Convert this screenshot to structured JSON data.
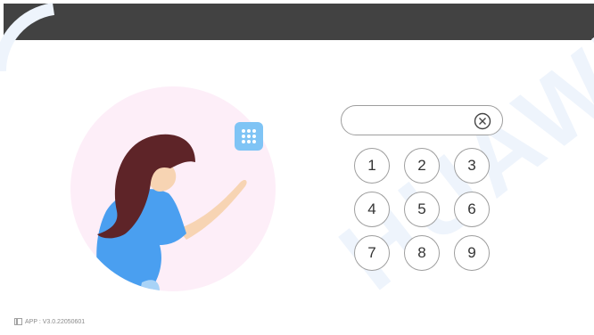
{
  "app": {
    "version_text": "APP : V3.0.22050601"
  },
  "keypad": {
    "keys": [
      "1",
      "2",
      "3",
      "4",
      "5",
      "6",
      "7",
      "8",
      "9"
    ]
  },
  "pin_input": {
    "value": ""
  },
  "watermark": {
    "text": "HUAWEI"
  },
  "icons": {
    "clear": "clear-circle-icon",
    "keypad": "keypad-grid-icon",
    "version": "device-icon"
  },
  "colors": {
    "topbar": "#424242",
    "keypad_icon_bg": "#7fc4f5",
    "circle_bg": "#fdeef8",
    "hair": "#5e2428",
    "shirt": "#4a9ff0",
    "skin": "#f7d4b3"
  }
}
